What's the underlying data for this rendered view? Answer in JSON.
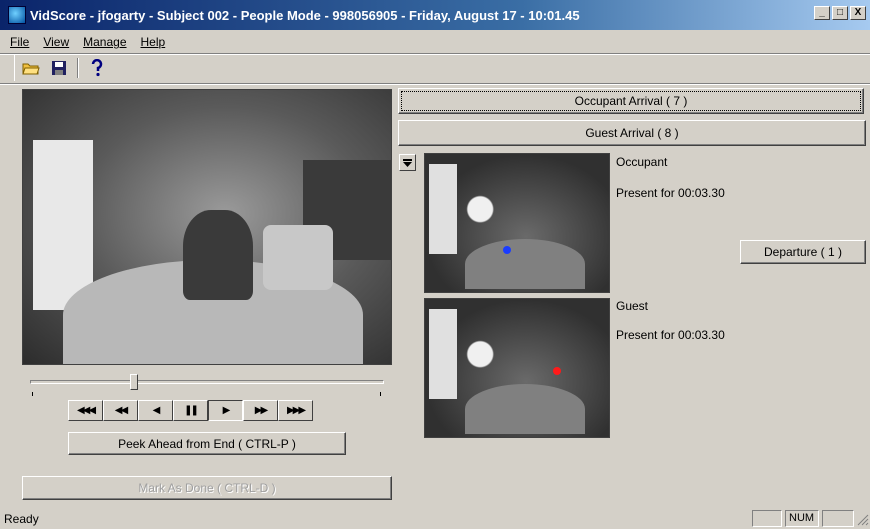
{
  "window": {
    "title": "VidScore - jfogarty - Subject 002 - People Mode - 998056905 - Friday, August 17 - 10:01.45",
    "min_label": "_",
    "max_label": "□",
    "close_label": "X"
  },
  "menu": [
    {
      "label": "File"
    },
    {
      "label": "View"
    },
    {
      "label": "Manage"
    },
    {
      "label": "Help"
    }
  ],
  "toolbar": {
    "icons": [
      "open-folder-icon",
      "save-icon",
      "help-icon"
    ]
  },
  "transport": {
    "buttons": [
      {
        "name": "rewind-fast",
        "label": "◀◀◀"
      },
      {
        "name": "rewind",
        "label": "◀◀"
      },
      {
        "name": "step-back",
        "label": "◀"
      },
      {
        "name": "pause",
        "label": "❚❚"
      },
      {
        "name": "play",
        "label": "▶"
      },
      {
        "name": "fast-forward",
        "label": "▶▶"
      },
      {
        "name": "fast-forward-fast",
        "label": "▶▶▶"
      }
    ],
    "slider_position": 0.29
  },
  "left": {
    "peek_label": "Peek Ahead from End ( CTRL-P )",
    "mark_done_label": "Mark As Done ( CTRL-D )"
  },
  "right": {
    "occupant_arrival_label": "Occupant Arrival ( 7 )",
    "guest_arrival_label": "Guest Arrival ( 8 )",
    "departure_label": "Departure ( 1 )",
    "occupant": {
      "role": "Occupant",
      "present": "Present for 00:03.30",
      "marker_color": "#1a3cff"
    },
    "guest": {
      "role": "Guest",
      "present": "Present for 00:03.30",
      "marker_color": "#ff1a1a"
    }
  },
  "status": {
    "text": "Ready",
    "num": "NUM"
  },
  "colors": {
    "face": "#d4d0c8",
    "titlebar": "#0a246a"
  }
}
